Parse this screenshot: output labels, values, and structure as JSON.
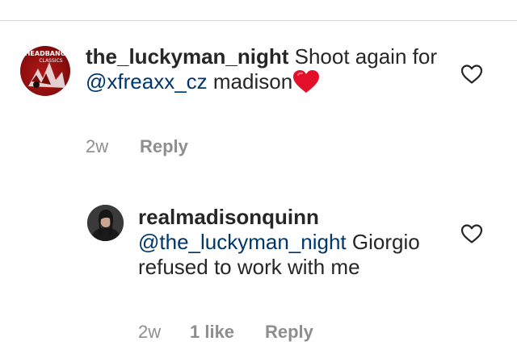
{
  "comments": [
    {
      "username": "the_luckyman_night",
      "text_after_username": " Shoot again for ",
      "mention": "@xfreaxx_cz",
      "text_end": " madison",
      "emoji": "heart-emoji",
      "avatar_text_top": "HEADBANG",
      "avatar_text_mid": "CLASSICS",
      "time": "2w",
      "reply_label": "Reply",
      "like_icon": "heart-outline-icon"
    },
    {
      "username": "realmadisonquinn",
      "mention": "@the_luckyman_night",
      "text_after_mention": " Giorgio refused to work with me",
      "time": "2w",
      "likes": "1 like",
      "reply_label": "Reply",
      "like_icon": "heart-outline-icon"
    }
  ],
  "colors": {
    "text": "#262626",
    "meta": "#8e8e8e",
    "mention": "#00376b",
    "divider": "#dbdbdb",
    "heart": "#e3102a"
  }
}
